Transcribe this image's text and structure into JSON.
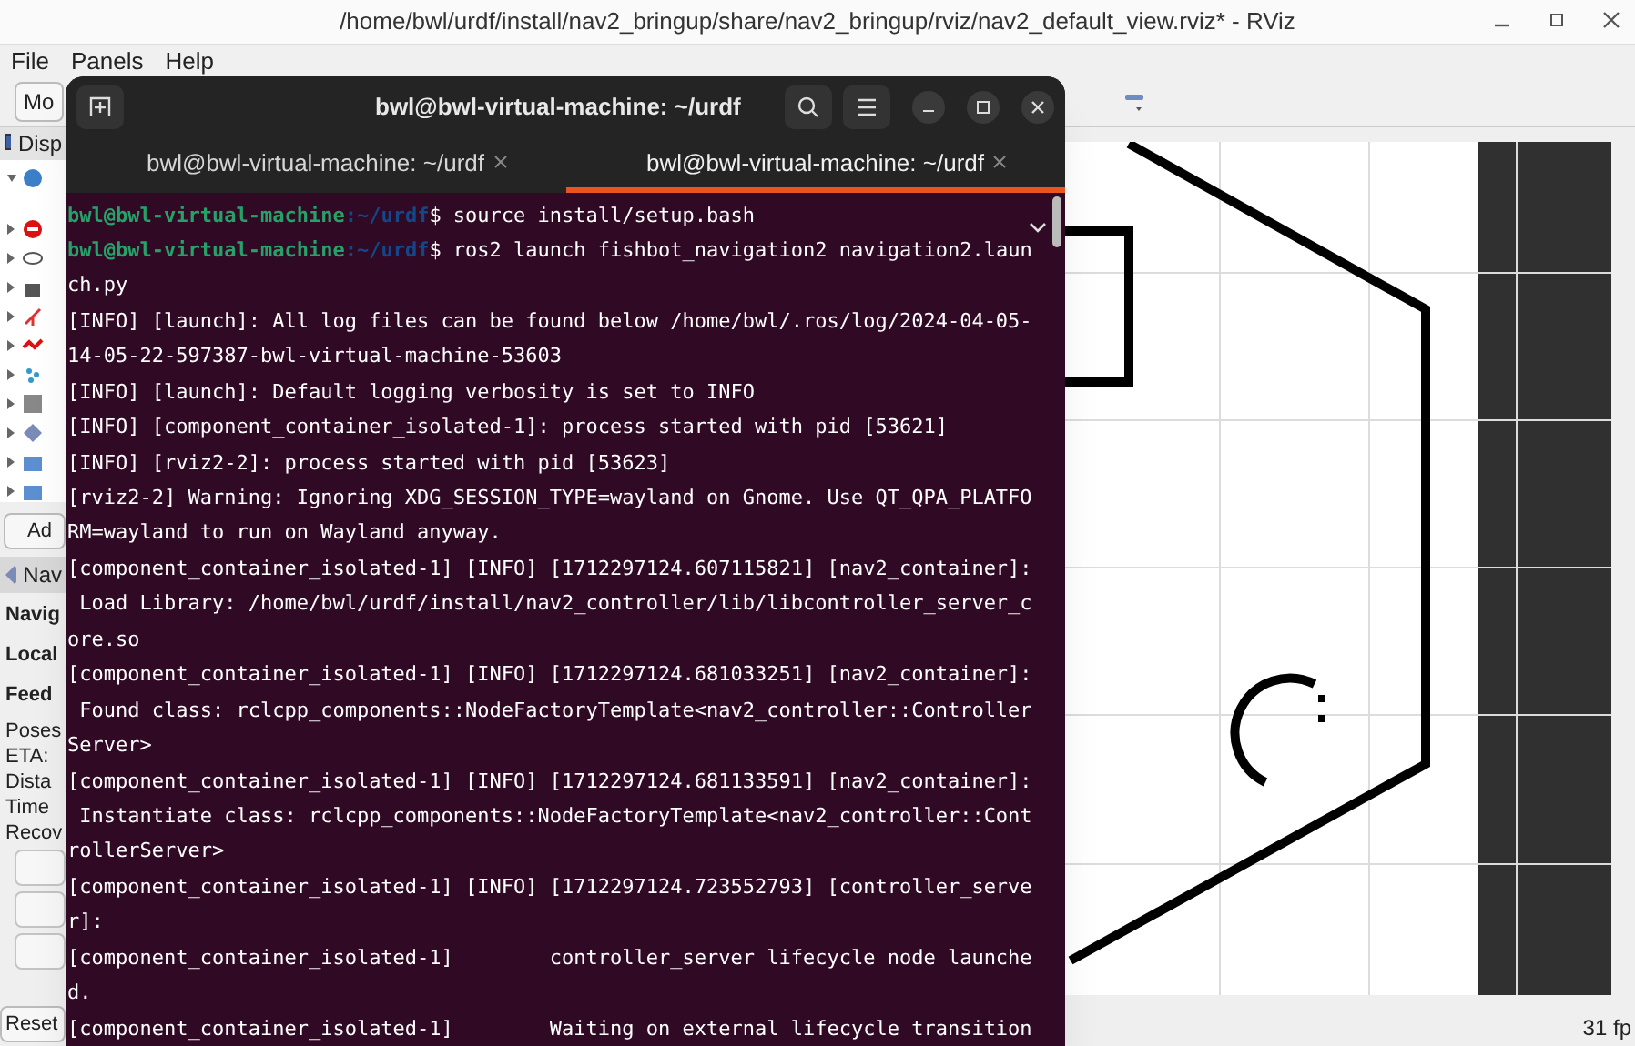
{
  "window": {
    "title": "/home/bwl/urdf/install/nav2_bringup/share/nav2_bringup/rviz/nav2_default_view.rviz* - RViz"
  },
  "menu": [
    "File",
    "Panels",
    "Help"
  ],
  "toolbar": {
    "tool": "Mo"
  },
  "displays_panel": {
    "title": "Disp",
    "add_button": "Ad"
  },
  "navigation_panel": {
    "title": "Nav",
    "labels": [
      {
        "text": "Navig",
        "kind": "heading"
      },
      {
        "text": "Local",
        "kind": "heading"
      },
      {
        "text": "Feed",
        "kind": "heading"
      },
      {
        "text": "Poses",
        "kind": "plain"
      },
      {
        "text": "ETA:",
        "kind": "plain"
      },
      {
        "text": "Dista",
        "kind": "plain"
      },
      {
        "text": "Time",
        "kind": "plain"
      },
      {
        "text": "Recov",
        "kind": "plain"
      }
    ],
    "reset_button": "Reset"
  },
  "status_bar": {
    "fps": "31 fp"
  },
  "terminal": {
    "title": "bwl@bwl-virtual-machine: ~/urdf",
    "tabs": [
      {
        "label": "bwl@bwl-virtual-machine: ~/urdf",
        "selected": false
      },
      {
        "label": "bwl@bwl-virtual-machine: ~/urdf",
        "selected": true
      }
    ],
    "lines": [
      {
        "kind": "prompt",
        "user": "bwl@bwl-virtual-machine",
        "path": ":~/urdf",
        "text": "$ source install/setup.bash"
      },
      {
        "kind": "prompt",
        "user": "bwl@bwl-virtual-machine",
        "path": ":~/urdf",
        "text": "$ ros2 launch fishbot_navigation2 navigation2.laun"
      },
      {
        "kind": "output",
        "text": "ch.py"
      },
      {
        "kind": "output",
        "text": "[INFO] [launch]: All log files can be found below /home/bwl/.ros/log/2024-04-05-"
      },
      {
        "kind": "output",
        "text": "14-05-22-597387-bwl-virtual-machine-53603"
      },
      {
        "kind": "output",
        "text": "[INFO] [launch]: Default logging verbosity is set to INFO"
      },
      {
        "kind": "output",
        "text": "[INFO] [component_container_isolated-1]: process started with pid [53621]"
      },
      {
        "kind": "output",
        "text": "[INFO] [rviz2-2]: process started with pid [53623]"
      },
      {
        "kind": "output",
        "text": "[rviz2-2] Warning: Ignoring XDG_SESSION_TYPE=wayland on Gnome. Use QT_QPA_PLATFO"
      },
      {
        "kind": "output",
        "text": "RM=wayland to run on Wayland anyway."
      },
      {
        "kind": "output",
        "text": "[component_container_isolated-1] [INFO] [1712297124.607115821] [nav2_container]:"
      },
      {
        "kind": "output",
        "text": " Load Library: /home/bwl/urdf/install/nav2_controller/lib/libcontroller_server_c"
      },
      {
        "kind": "output",
        "text": "ore.so"
      },
      {
        "kind": "output",
        "text": "[component_container_isolated-1] [INFO] [1712297124.681033251] [nav2_container]:"
      },
      {
        "kind": "output",
        "text": " Found class: rclcpp_components::NodeFactoryTemplate<nav2_controller::Controller"
      },
      {
        "kind": "output",
        "text": "Server>"
      },
      {
        "kind": "output",
        "text": "[component_container_isolated-1] [INFO] [1712297124.681133591] [nav2_container]:"
      },
      {
        "kind": "output",
        "text": " Instantiate class: rclcpp_components::NodeFactoryTemplate<nav2_controller::Cont"
      },
      {
        "kind": "output",
        "text": "rollerServer>"
      },
      {
        "kind": "output",
        "text": "[component_container_isolated-1] [INFO] [1712297124.723552793] [controller_serve"
      },
      {
        "kind": "output",
        "text": "r]:"
      },
      {
        "kind": "output",
        "text": "[component_container_isolated-1]        controller_server lifecycle node launche"
      },
      {
        "kind": "output",
        "text": "d."
      },
      {
        "kind": "output",
        "text": "[component_container_isolated-1]        Waiting on external lifecycle transition"
      }
    ]
  }
}
